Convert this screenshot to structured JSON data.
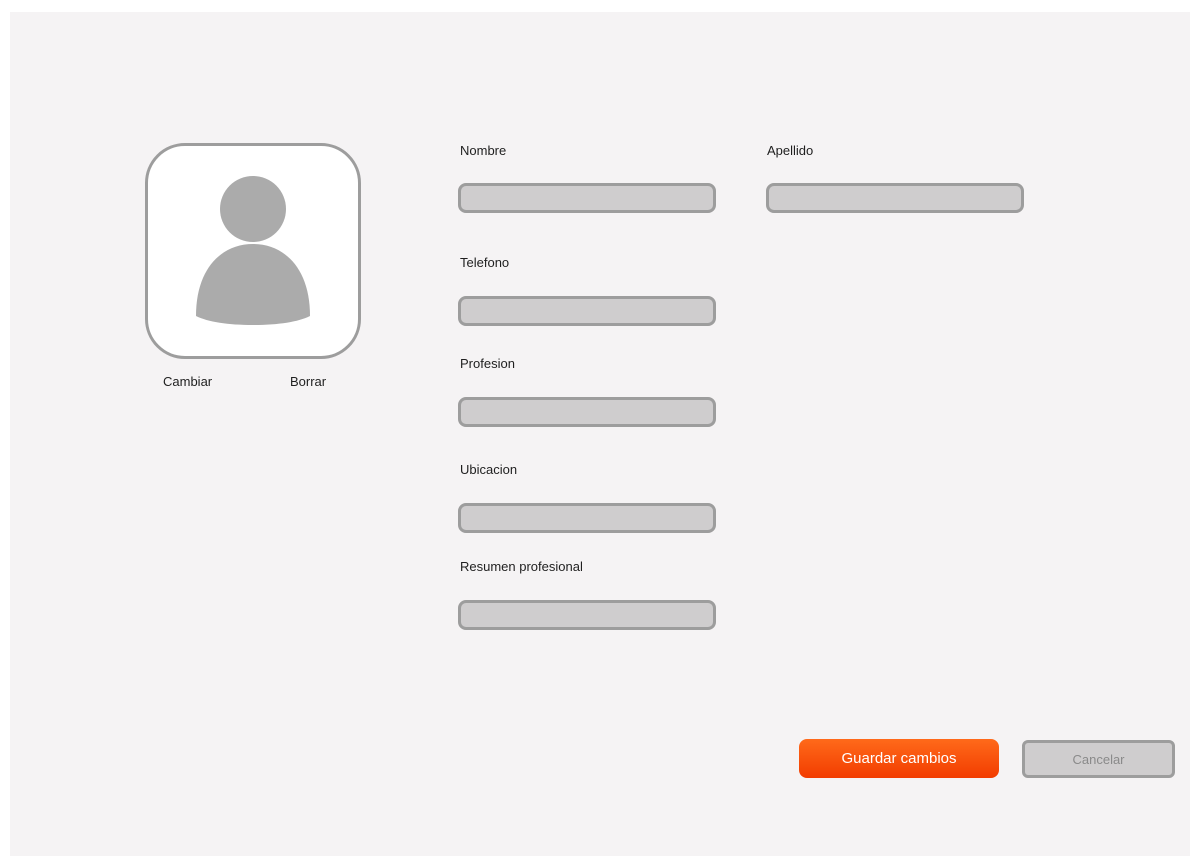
{
  "avatar": {
    "icon": "user-silhouette-icon",
    "change_label": "Cambiar",
    "delete_label": "Borrar"
  },
  "form": {
    "nombre": {
      "label": "Nombre",
      "value": ""
    },
    "apellido": {
      "label": "Apellido",
      "value": ""
    },
    "telefono": {
      "label": "Telefono",
      "value": ""
    },
    "profesion": {
      "label": "Profesion",
      "value": ""
    },
    "ubicacion": {
      "label": "Ubicacion",
      "value": ""
    },
    "resumen": {
      "label": "Resumen profesional",
      "value": ""
    }
  },
  "actions": {
    "save_label": "Guardar cambios",
    "cancel_label": "Cancelar"
  },
  "colors": {
    "background": "#f5f3f4",
    "input_fill": "#cfcdce",
    "border": "#9d9d9d",
    "accent": "#f23c00"
  }
}
